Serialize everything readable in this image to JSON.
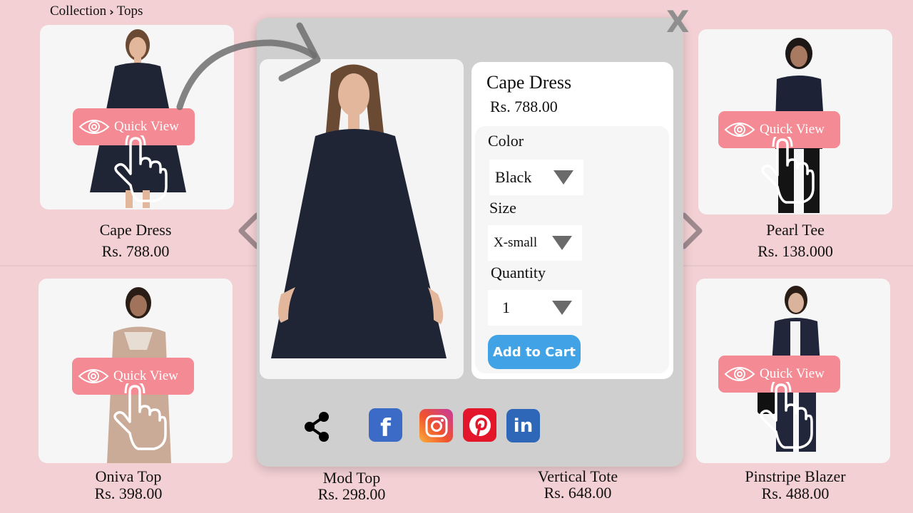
{
  "breadcrumb": {
    "root": "Collection",
    "current": "Tops"
  },
  "quick_view_label": "Quick View",
  "products": [
    {
      "name": "Cape Dress",
      "price": "Rs. 788.00"
    },
    {
      "name": "Pearl Tee",
      "price": "Rs. 138.000"
    },
    {
      "name": "Oniva Top",
      "price": "Rs. 398.00"
    },
    {
      "name": "Mod Top",
      "price": "Rs. 298.00"
    },
    {
      "name": "Vertical Tote",
      "price": "Rs. 648.00"
    },
    {
      "name": "Pinstripe Blazer",
      "price": "Rs. 488.00"
    }
  ],
  "modal": {
    "close_label": "X",
    "title": "Cape Dress",
    "price": "Rs. 788.00",
    "color_label": "Color",
    "color_value": "Black",
    "size_label": "Size",
    "size_value": "X-small",
    "quantity_label": "Quantity",
    "quantity_value": "1",
    "add_to_cart": "Add to Cart",
    "share": {
      "share_icon": "share-icon",
      "networks": [
        "facebook",
        "instagram",
        "pinterest",
        "linkedin"
      ]
    }
  },
  "colors": {
    "background": "#f2d0d3",
    "quick_view": "#f48a93",
    "add_to_cart": "#41a3e6",
    "modal_bg": "#cfcfcf"
  }
}
